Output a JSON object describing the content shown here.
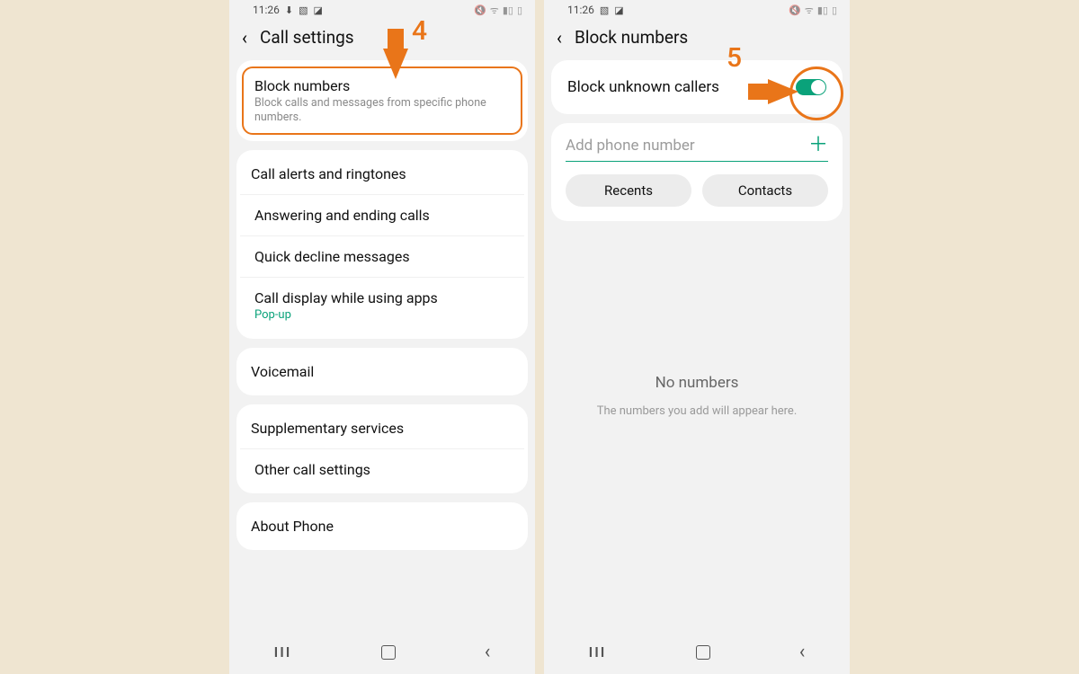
{
  "status": {
    "time": "11:26",
    "left_icons": [
      "download-icon",
      "image-icon",
      "app-icon"
    ],
    "left_icons_b": [
      "image-icon",
      "app-icon"
    ],
    "right_icons": [
      "mute-icon",
      "wifi-icon",
      "signal-icon",
      "battery-icon"
    ]
  },
  "left": {
    "title": "Call settings",
    "anno_num": "4",
    "groups": [
      [
        {
          "title": "Block numbers",
          "sub": "Block calls and messages from specific phone numbers.",
          "highlight": true
        }
      ],
      [
        {
          "title": "Call alerts and ringtones"
        },
        {
          "title": "Answering and ending calls"
        },
        {
          "title": "Quick decline messages"
        },
        {
          "title": "Call display while using apps",
          "sub": "Pop-up",
          "sub_green": true
        }
      ],
      [
        {
          "title": "Voicemail"
        }
      ],
      [
        {
          "title": "Supplementary services"
        },
        {
          "title": "Other call settings"
        }
      ],
      [
        {
          "title": "About Phone"
        }
      ]
    ]
  },
  "right": {
    "title": "Block numbers",
    "anno_num": "5",
    "toggle_label": "Block unknown callers",
    "toggle_on": true,
    "input_placeholder": "Add phone number",
    "pill_a": "Recents",
    "pill_b": "Contacts",
    "empty_title": "No numbers",
    "empty_sub": "The numbers you add will appear here."
  },
  "nav": {
    "recents": "III",
    "home": "",
    "back": "‹"
  }
}
